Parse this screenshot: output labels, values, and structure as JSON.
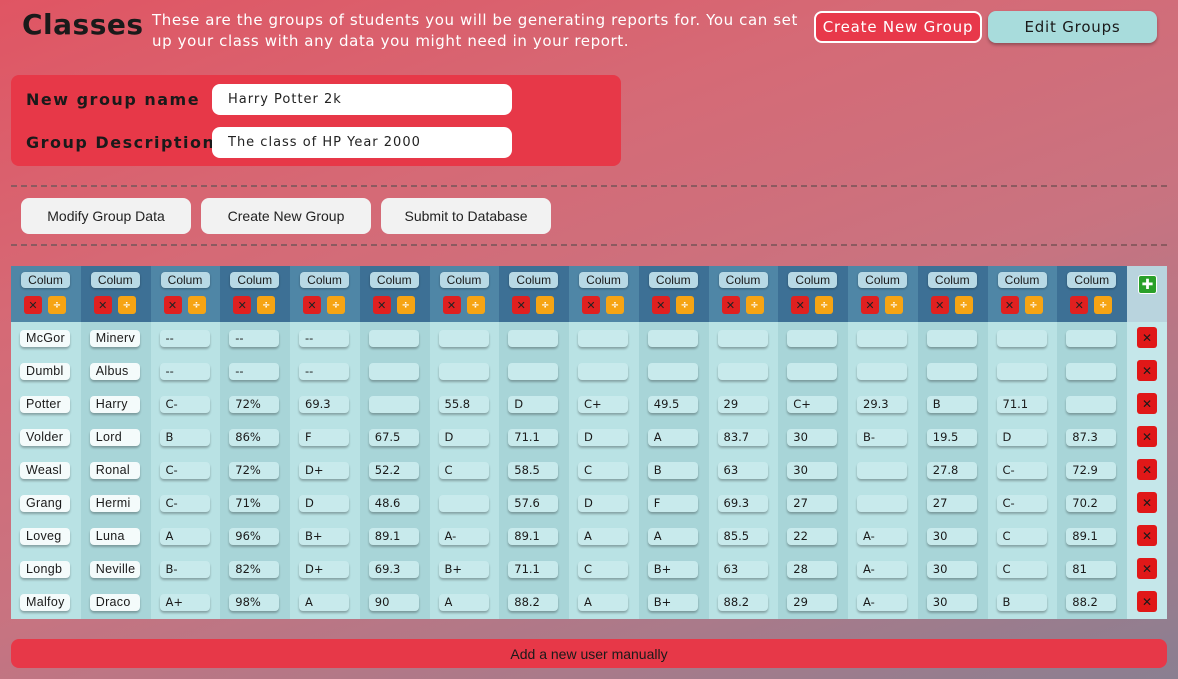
{
  "header": {
    "title": "Classes",
    "subtitle": "These are the groups of students you will be generating reports for. You can set up your class with any data you might need in your report.",
    "create_button": "Create New Group",
    "edit_button": "Edit Groups"
  },
  "form": {
    "name_label": "New group name",
    "name_value": "Harry Potter 2k",
    "description_label": "Group Description",
    "description_value": "The class of HP Year 2000"
  },
  "actions": {
    "modify": "Modify Group Data",
    "create": "Create New Group",
    "submit": "Submit to Database"
  },
  "table": {
    "column_label": "Colum",
    "delete_icon": "✕",
    "divide_icon": "÷",
    "add_column_icon": "✚",
    "row_delete_icon": "✕",
    "rows": [
      [
        "McGor",
        "Minerv",
        "--",
        "--",
        "--",
        "",
        "",
        "",
        "",
        "",
        "",
        "",
        "",
        "",
        "",
        ""
      ],
      [
        "Dumbl",
        "Albus",
        "--",
        "--",
        "--",
        "",
        "",
        "",
        "",
        "",
        "",
        "",
        "",
        "",
        "",
        ""
      ],
      [
        "Potter",
        "Harry",
        "C-",
        "72%",
        "69.3",
        "",
        "55.8",
        "D",
        "C+",
        "49.5",
        "29",
        "C+",
        "29.3",
        "B",
        "71.1",
        ""
      ],
      [
        "Volder",
        "Lord",
        "B",
        "86%",
        "F",
        "67.5",
        "D",
        "71.1",
        "D",
        "A",
        "83.7",
        "30",
        "B-",
        "19.5",
        "D",
        "87.3"
      ],
      [
        "Weasl",
        "Ronal",
        "C-",
        "72%",
        "D+",
        "52.2",
        "C",
        "58.5",
        "C",
        "B",
        "63",
        "30",
        "",
        "27.8",
        "C-",
        "72.9"
      ],
      [
        "Grang",
        "Hermi",
        "C-",
        "71%",
        "D",
        "48.6",
        "",
        "57.6",
        "D",
        "F",
        "69.3",
        "27",
        "",
        "27",
        "C-",
        "70.2"
      ],
      [
        "Loveg",
        "Luna",
        "A",
        "96%",
        "B+",
        "89.1",
        "A-",
        "89.1",
        "A",
        "A",
        "85.5",
        "22",
        "A-",
        "30",
        "C",
        "89.1"
      ],
      [
        "Longb",
        "Neville",
        "B-",
        "82%",
        "D+",
        "69.3",
        "B+",
        "71.1",
        "C",
        "B+",
        "63",
        "28",
        "A-",
        "30",
        "C",
        "81"
      ],
      [
        "Malfoy",
        "Draco",
        "A+",
        "98%",
        "A",
        "90",
        "A",
        "88.2",
        "A",
        "B+",
        "88.2",
        "29",
        "A-",
        "30",
        "B",
        "88.2"
      ]
    ]
  },
  "footer": {
    "add_user": "Add a new user manually"
  }
}
